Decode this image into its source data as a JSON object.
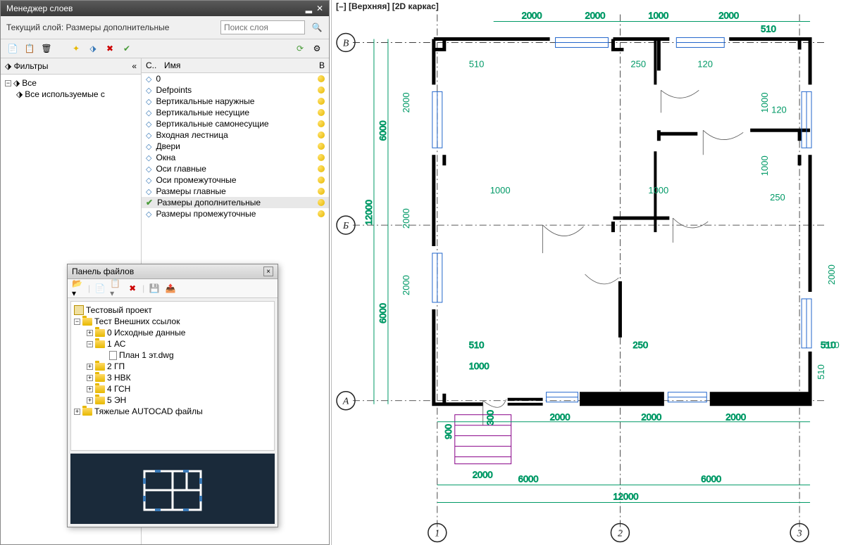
{
  "layerManager": {
    "title": "Менеджер слоев",
    "currentLayerLabel": "Текущий слой: Размеры дополнительные",
    "searchPlaceholder": "Поиск слоя",
    "filtersTitle": "Фильтры",
    "filterTree": {
      "root": "Все",
      "child": "Все используемые с"
    },
    "columns": {
      "status": "С..",
      "name": "Имя",
      "on": "В"
    },
    "layers": [
      {
        "name": "0",
        "current": false
      },
      {
        "name": "Defpoints",
        "current": false
      },
      {
        "name": "Вертикальные наружные",
        "current": false
      },
      {
        "name": "Вертикальные несущие",
        "current": false
      },
      {
        "name": "Вертикальные самонесущие",
        "current": false
      },
      {
        "name": "Входная лестница",
        "current": false
      },
      {
        "name": "Двери",
        "current": false
      },
      {
        "name": "Окна",
        "current": false
      },
      {
        "name": "Оси главные",
        "current": false
      },
      {
        "name": "Оси промежуточные",
        "current": false
      },
      {
        "name": "Размеры главные",
        "current": false
      },
      {
        "name": "Размеры дополнительные",
        "current": true
      },
      {
        "name": "Размеры промежуточные",
        "current": false
      }
    ]
  },
  "filePanel": {
    "title": "Панель файлов",
    "project": "Тестовый проект",
    "rootFolder": "Тест Внешних ссылок",
    "folders": [
      {
        "name": "0 Исходные данные",
        "children": []
      },
      {
        "name": "1 АС",
        "expanded": true,
        "children": [
          {
            "name": "План 1 эт.dwg",
            "type": "file"
          }
        ]
      },
      {
        "name": "2 ГП",
        "children": []
      },
      {
        "name": "3 НВК",
        "children": []
      },
      {
        "name": "4 ГСН",
        "children": []
      },
      {
        "name": "5 ЭН",
        "children": []
      }
    ],
    "heavyFolder": "Тяжелые AUTOCAD файлы"
  },
  "viewport": {
    "label": "[–] [Верхняя] [2D каркас]",
    "axesLetters": [
      "А",
      "Б",
      "В"
    ],
    "axesNumbers": [
      "1",
      "2",
      "3"
    ],
    "dims": {
      "top": [
        "2000",
        "2000",
        "1000",
        "2000"
      ],
      "topInner": [
        "510",
        "250",
        "120"
      ],
      "topRight": "510",
      "rightInner": [
        "1000",
        "120",
        "1000",
        "250",
        "2000"
      ],
      "right": [
        "510",
        "510"
      ],
      "bottomInner1": [
        "510",
        "250"
      ],
      "bottomInner2": "510",
      "bottom1": [
        "1000",
        "2000",
        "2000",
        "2000"
      ],
      "bottom2": [
        "300",
        "900"
      ],
      "stair": "2000",
      "bottomMain": [
        "6000",
        "6000"
      ],
      "overall": "12000",
      "leftMain": [
        "6000",
        "6000"
      ],
      "leftInner": [
        "2000",
        "2000",
        "2000"
      ],
      "leftOverall": "12000",
      "centerDoors": [
        "1000",
        "1000"
      ]
    }
  }
}
